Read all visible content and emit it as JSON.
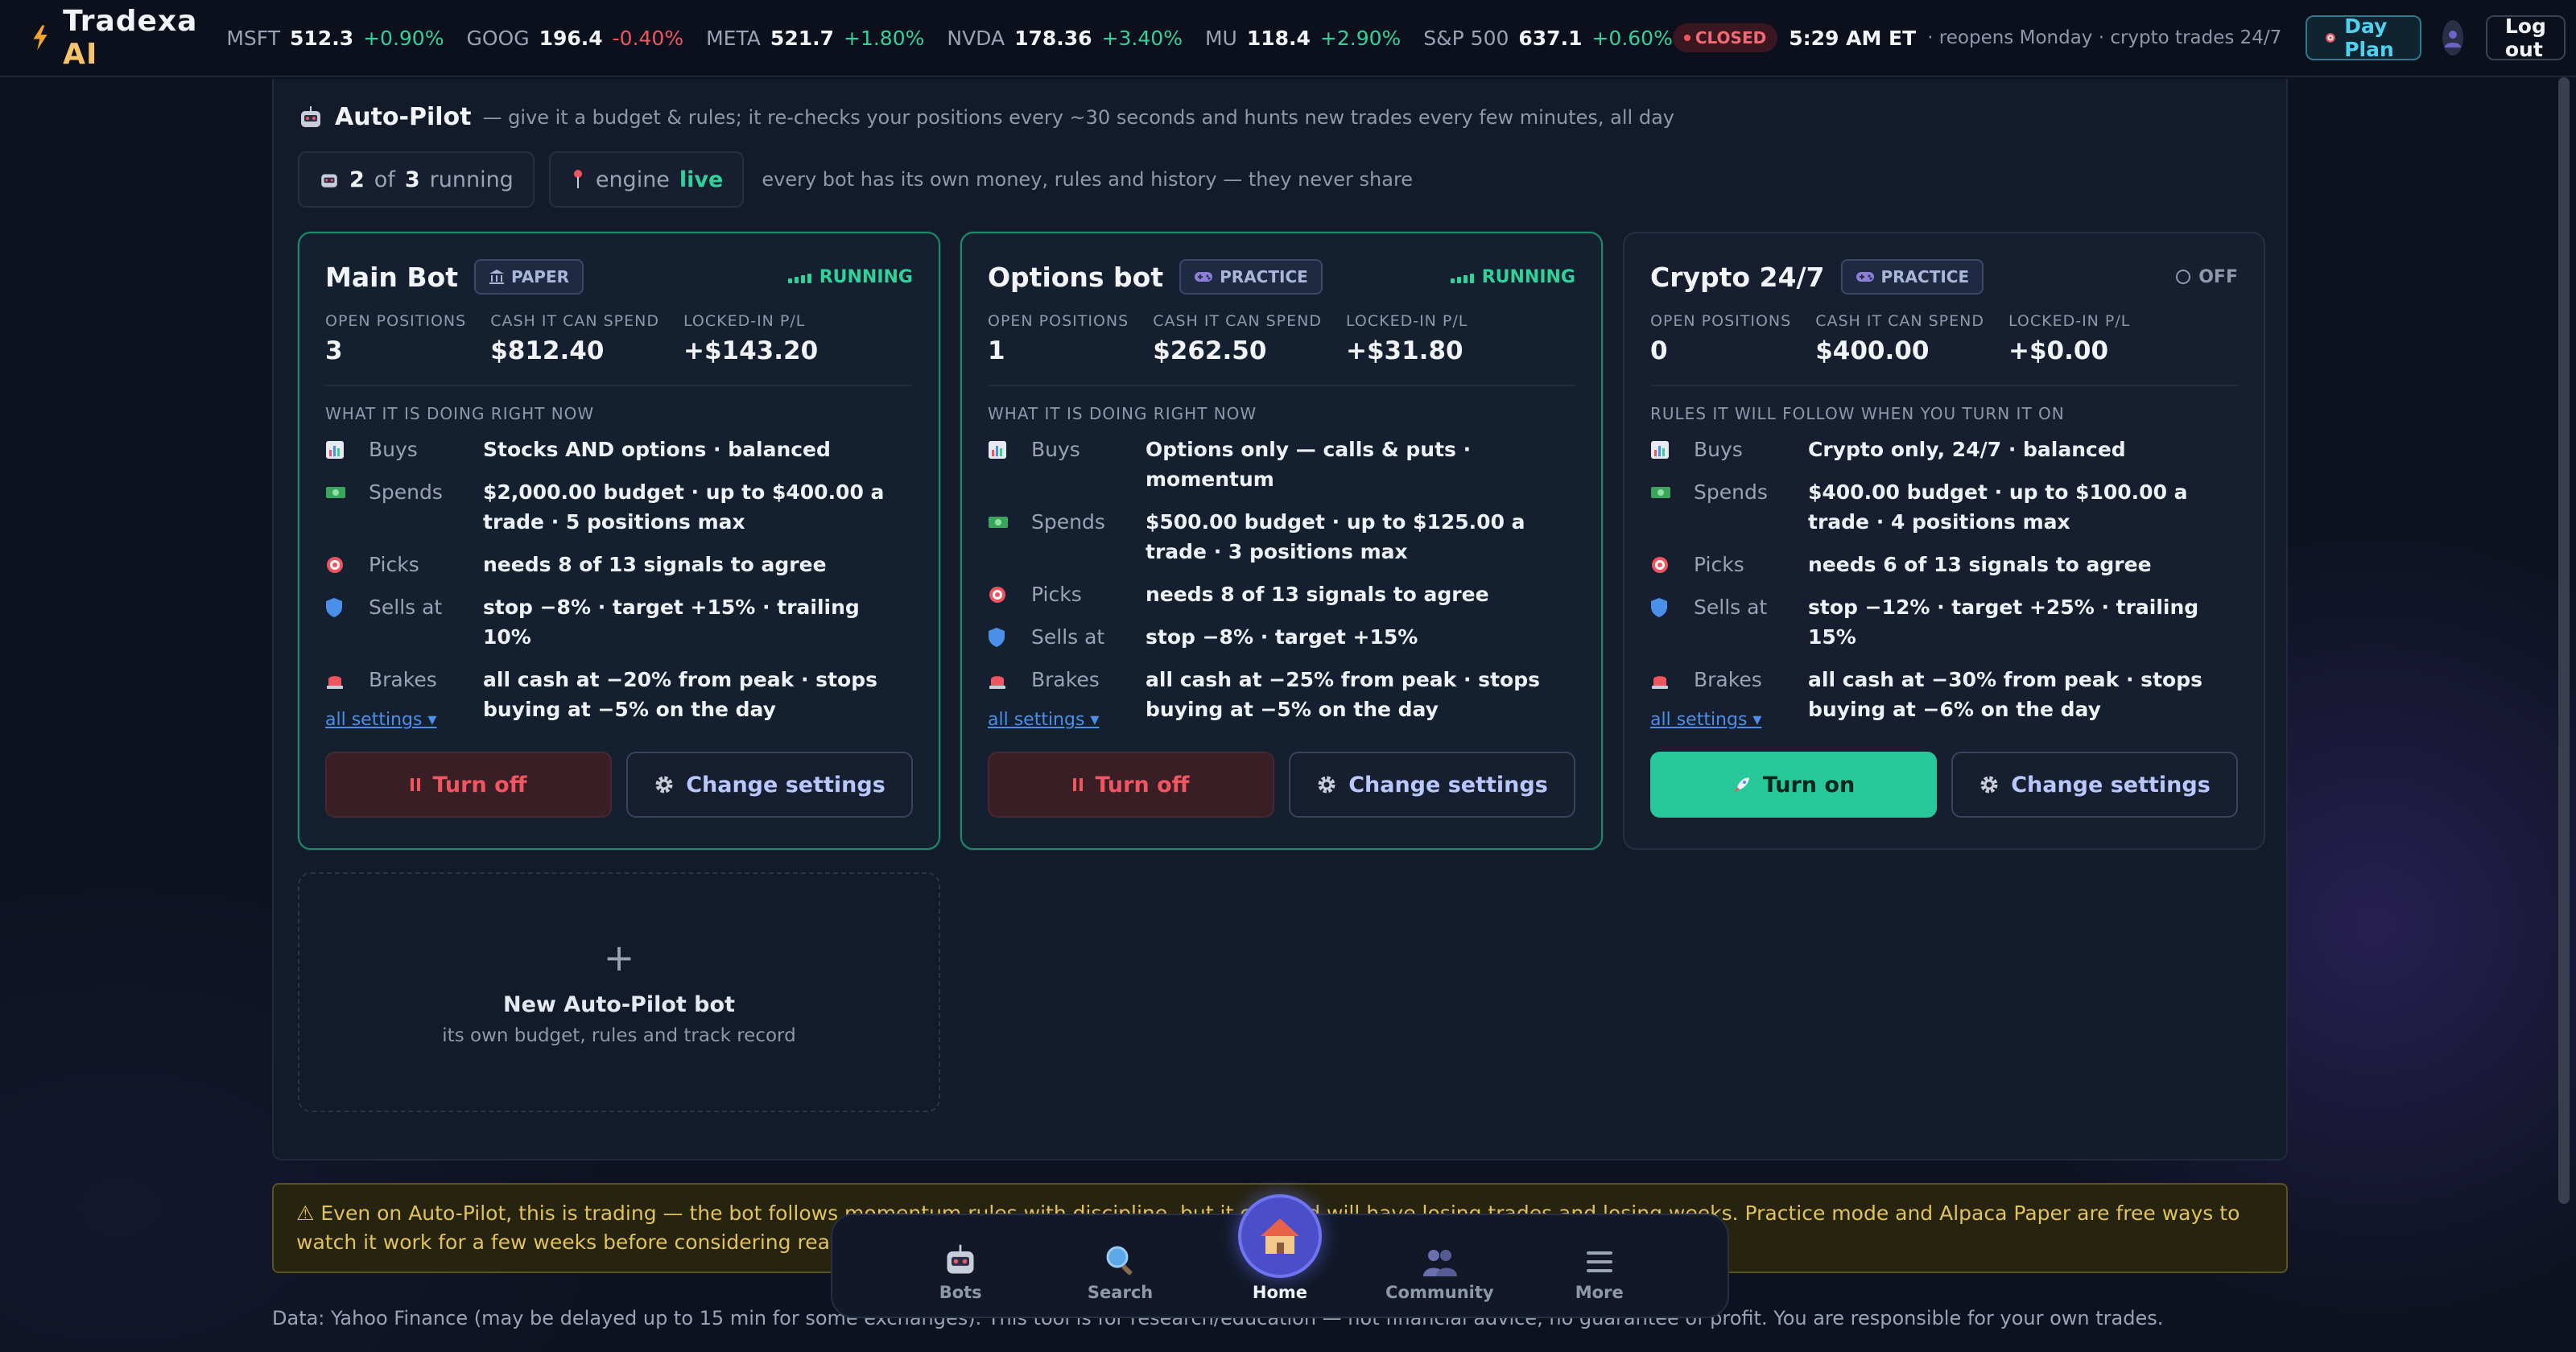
{
  "app": {
    "name": "Tradexa",
    "name_suffix": "AI"
  },
  "tickers": [
    {
      "symbol": "MSFT",
      "price": "512.3",
      "change": "+0.90%",
      "dir": "up"
    },
    {
      "symbol": "GOOG",
      "price": "196.4",
      "change": "-0.40%",
      "dir": "down"
    },
    {
      "symbol": "META",
      "price": "521.7",
      "change": "+1.80%",
      "dir": "up"
    },
    {
      "symbol": "NVDA",
      "price": "178.36",
      "change": "+3.40%",
      "dir": "up"
    },
    {
      "symbol": "MU",
      "price": "118.4",
      "change": "+2.90%",
      "dir": "up"
    },
    {
      "symbol": "S&P 500",
      "price": "637.1",
      "change": "+0.60%",
      "dir": "up"
    }
  ],
  "market": {
    "status": "CLOSED",
    "time": "5:29 AM ET",
    "note": "· reopens Monday · crypto trades 24/7"
  },
  "header": {
    "day_plan": "Day Plan",
    "logout": "Log out"
  },
  "autopilot": {
    "title": "Auto-Pilot",
    "description": "— give it a budget & rules; it re-checks your positions every ~30 seconds and hunts new trades every few minutes, all day",
    "running_count": "2",
    "of_label": "of",
    "total_count": "3",
    "running_label": "running",
    "engine_label": "engine",
    "engine_status": "live",
    "note": "every bot has its own money, rules and history — they never share"
  },
  "labels": {
    "open_positions": "OPEN POSITIONS",
    "cash": "CASH IT CAN SPEND",
    "pl": "LOCKED-IN P/L",
    "buys": "Buys",
    "spends": "Spends",
    "picks": "Picks",
    "sells": "Sells at",
    "brakes": "Brakes",
    "all_settings": "all settings ▾",
    "change_settings": "Change settings"
  },
  "bots": [
    {
      "name": "Main Bot",
      "mode": "PAPER",
      "status": "RUNNING",
      "open_positions": "3",
      "cash": "$812.40",
      "pl": "+$143.20",
      "section": "WHAT IT IS DOING RIGHT NOW",
      "buys": "Stocks AND options · balanced",
      "spends": "$2,000.00 budget · up to $400.00 a trade · 5 positions max",
      "picks": "needs 8 of 13 signals to agree",
      "sells": "stop −8% · target +15% · trailing 10%",
      "brakes": "all cash at −20% from peak · stops buying at −5% on the day",
      "action": "Turn off"
    },
    {
      "name": "Options bot",
      "mode": "PRACTICE",
      "status": "RUNNING",
      "open_positions": "1",
      "cash": "$262.50",
      "pl": "+$31.80",
      "section": "WHAT IT IS DOING RIGHT NOW",
      "buys": "Options only — calls & puts · momentum",
      "spends": "$500.00 budget · up to $125.00 a trade · 3 positions max",
      "picks": "needs 8 of 13 signals to agree",
      "sells": "stop −8% · target +15%",
      "brakes": "all cash at −25% from peak · stops buying at −5% on the day",
      "action": "Turn off"
    },
    {
      "name": "Crypto 24/7",
      "mode": "PRACTICE",
      "status": "OFF",
      "open_positions": "0",
      "cash": "$400.00",
      "pl": "+$0.00",
      "section": "RULES IT WILL FOLLOW WHEN YOU TURN IT ON",
      "buys": "Crypto only, 24/7 · balanced",
      "spends": "$400.00 budget · up to $100.00 a trade · 4 positions max",
      "picks": "needs 6 of 13 signals to agree",
      "sells": "stop −12% · target +25% · trailing 15%",
      "brakes": "all cash at −30% from peak · stops buying at −6% on the day",
      "action": "Turn on"
    }
  ],
  "new_bot": {
    "title": "New Auto-Pilot bot",
    "subtitle": "its own budget, rules and track record"
  },
  "warning": "⚠ Even on Auto-Pilot, this is trading — the bot follows momentum rules with discipline, but it can and will have losing trades and losing weeks. Practice mode and Alpaca Paper are free ways to watch it work for a few weeks before considering real money. Real-money r",
  "footer": "Data: Yahoo Finance (may be delayed up to 15 min for some exchanges). This tool is for research/education — not financial advice, no guarantee of profit. You are responsible for your own trades.",
  "nav": [
    {
      "label": "Bots"
    },
    {
      "label": "Search"
    },
    {
      "label": "Home"
    },
    {
      "label": "Community"
    },
    {
      "label": "More"
    }
  ],
  "colors": {
    "accent": "#2fd39a",
    "danger": "#f0555f",
    "brand": "#f5c46b",
    "link": "#4a8fe8"
  }
}
